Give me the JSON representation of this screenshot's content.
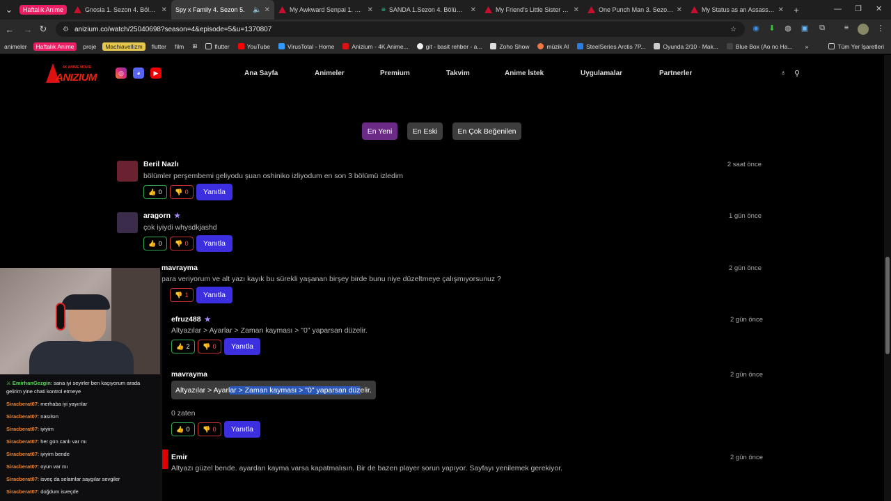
{
  "browser": {
    "tab_group": "Haftalık Anime",
    "tabs": [
      {
        "title": "Gnosia 1. Sezon 4. Bölüm İz",
        "icon": "red"
      },
      {
        "title": "Spy x Family 4. Sezon 5.",
        "icon": "red",
        "active": true
      },
      {
        "title": "My Awkward Senpai 1. Sezo",
        "icon": "red"
      },
      {
        "title": "SANDA 1.Sezon 4. Bölüm İz",
        "icon": "green"
      },
      {
        "title": "My Friend's Little Sister Ha:",
        "icon": "red"
      },
      {
        "title": "One Punch Man 3. Sezon 4.",
        "icon": "red"
      },
      {
        "title": "My Status as an Assassin Ob",
        "icon": "red"
      }
    ],
    "url": "anizium.co/watch/25040698?season=4&episode=5&u=1370807",
    "bookmarks": [
      "animeler",
      "Haftalık Anime",
      "proje",
      "Machiavellizm",
      "flutter",
      "film",
      "flutter",
      "YouTube",
      "VirusTotal - Home",
      "Anizium - 4K Anime...",
      "git - basit rehber - a...",
      "Zoho Show",
      "müzik Al",
      "SteelSeries Arctis 7P...",
      "Oyunda 2/10 - Mak...",
      "Blue Box (Ao no Ha..."
    ],
    "bookmarks_all": "Tüm Yer İşaretleri"
  },
  "site": {
    "logo_top": "4K ANIME MOVIE",
    "logo": "ANIZIUM",
    "menu": [
      "Ana Sayfa",
      "Animeler",
      "Premium",
      "Takvim",
      "Anime İstek",
      "Uygulamalar",
      "Partnerler"
    ],
    "sort": [
      "En Yeni",
      "En Eski",
      "En Çok Beğenilen"
    ],
    "reply_label": "Yanıtla",
    "comments": [
      {
        "name": "Beril Nazlı",
        "text": "bölümler perşembemi geliyodu şuan oshiniko izliyodum en son 3 bölümü izledim",
        "time": "2 saat önce",
        "likes": "0",
        "dislikes": "0"
      },
      {
        "name": "aragorn",
        "text": "çok iyiydi whysdkjashd",
        "time": "1 gün önce",
        "likes": "0",
        "dislikes": "0"
      },
      {
        "name": "mavrayma",
        "text": "para veriyorum ve alt yazı kayık bu sürekli yaşanan birşey birde bunu niye düzeltmeye çalışmıyorsunuz ?",
        "time": "2 gün önce",
        "likes": "",
        "dislikes": "1"
      },
      {
        "name": "efruz488",
        "text": "Altyazılar > Ayarlar > Zaman kayması > \"0\" yaparsan düzelir.",
        "time": "2 gün önce",
        "likes": "2",
        "dislikes": "0"
      },
      {
        "name": "mavrayma",
        "quote_a": "Altyazılar > Ayarl",
        "quote_b": "ar > Zaman kayması > \"0\" yaparsan düz",
        "quote_c": "elir.",
        "text": "0 zaten",
        "time": "2 gün önce",
        "likes": "0",
        "dislikes": "0"
      },
      {
        "name": "Emir",
        "text": "Altyazı güzel bende. ayardan kayma varsa kapatmalısın. Bir de bazen player sorun yapıyor. Sayfayı yenilemek gerekiyor.",
        "time": "2 gün önce"
      }
    ]
  },
  "chat": [
    {
      "user": "EmirhanGezgin",
      "msg": ": sana iyi seyirler ben kaçıyorum arada",
      "cont": "gelirim yine chati kontrol etmeye"
    },
    {
      "user": "Siracberat07",
      "msg": ": merhaba iyi yayınlar"
    },
    {
      "user": "Siracberat07",
      "msg": ": nasılsın"
    },
    {
      "user": "Siracberat07",
      "msg": ": iyiyim"
    },
    {
      "user": "Siracberat07",
      "msg": ": her gün canlı var mı"
    },
    {
      "user": "Siracberat07",
      "msg": ": iyiyim bende"
    },
    {
      "user": "Siracberat07",
      "msg": ": oyun var mı"
    },
    {
      "user": "Siracberat07",
      "msg": ": isveç da selamlar saygılar sevgiler"
    },
    {
      "user": "Siracberat07",
      "msg": ": doğdum isveçde"
    }
  ]
}
